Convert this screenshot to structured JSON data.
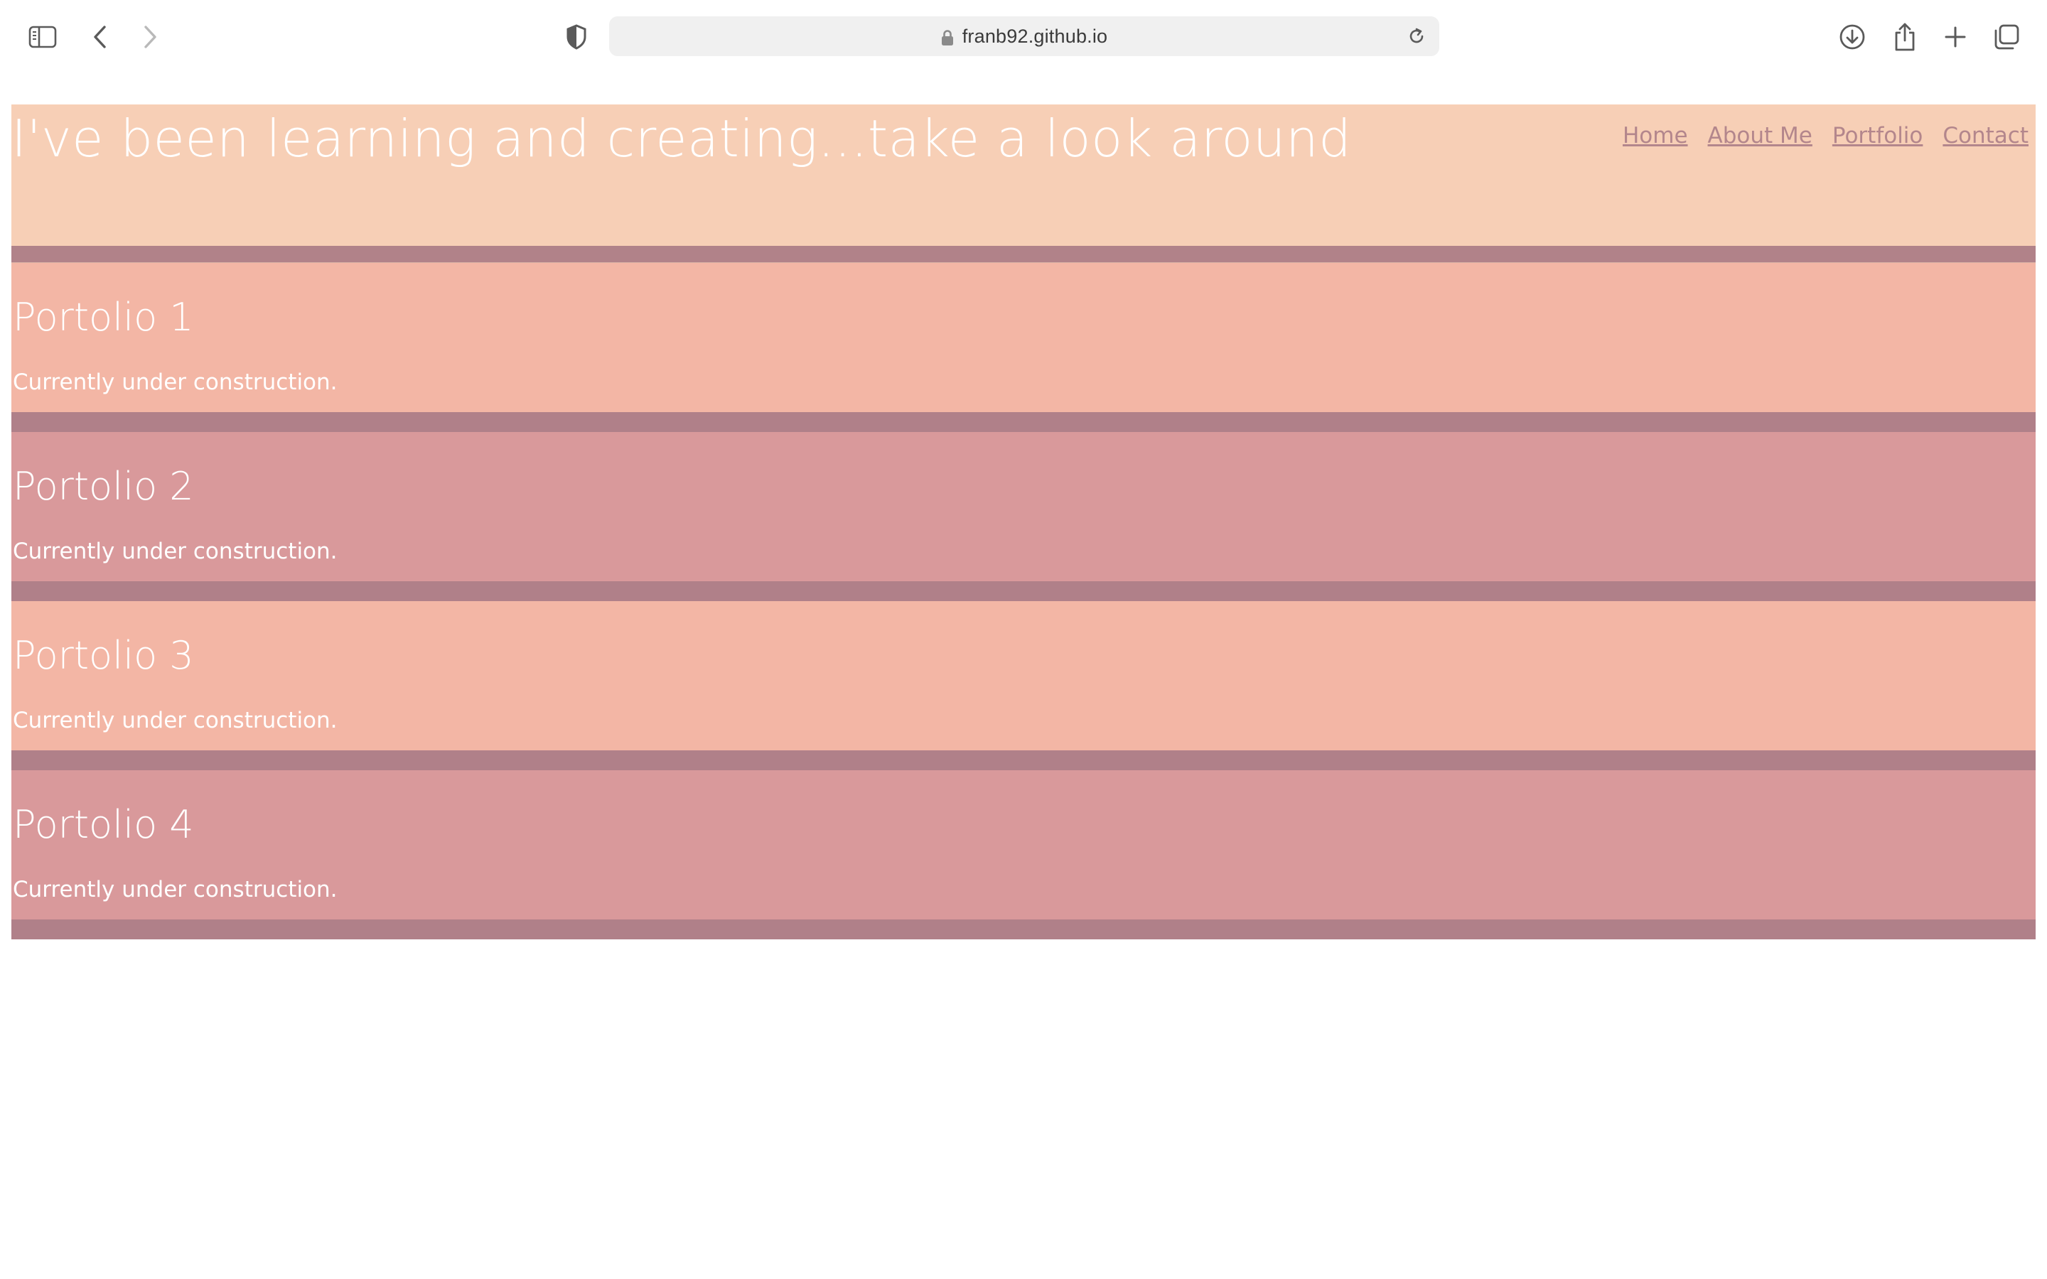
{
  "browser": {
    "url": "franb92.github.io",
    "icons": {
      "sidebar": "sidebar-icon",
      "back": "chevron-left-icon",
      "forward": "chevron-right-icon",
      "privacy": "shield-icon",
      "lock": "lock-icon",
      "reload": "reload-icon",
      "downloads": "download-icon",
      "share": "share-icon",
      "new_tab": "plus-icon",
      "tabs": "tab-overview-icon"
    }
  },
  "header": {
    "title": "I've been learning and creating...take a look around",
    "nav": [
      {
        "label": "Home"
      },
      {
        "label": "About Me"
      },
      {
        "label": "Portfolio"
      },
      {
        "label": "Contact"
      }
    ]
  },
  "sections": [
    {
      "title": "Portolio 1",
      "text": "Currently under construction."
    },
    {
      "title": "Portolio 2",
      "text": "Currently under construction."
    },
    {
      "title": "Portolio 3",
      "text": "Currently under construction."
    },
    {
      "title": "Portolio 4",
      "text": "Currently under construction."
    }
  ],
  "colors": {
    "header_bg": "#f7cfb6",
    "section_light": "#f3b6a5",
    "section_dark": "#d9999b",
    "divider": "#b08089",
    "nav_link": "#b3868c",
    "text": "#ffffff"
  }
}
